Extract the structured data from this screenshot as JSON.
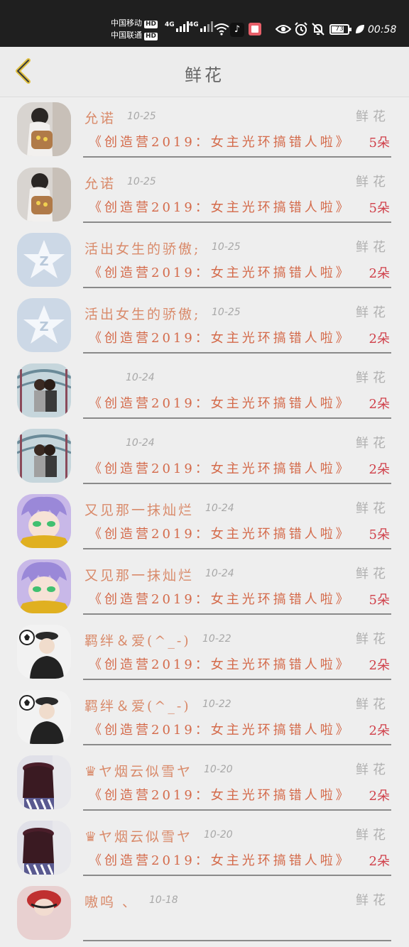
{
  "status_bar": {
    "carrier1": "中国移动",
    "carrier2": "中国联通",
    "hd_badge": "HD",
    "network1": "4G",
    "network2": "4G",
    "battery": "73",
    "time": "00:58",
    "icons": [
      "signal-icon",
      "wifi-icon",
      "tiktok-icon",
      "reader-app-icon",
      "eye-icon",
      "alarm-icon",
      "mute-bell-icon",
      "battery-icon",
      "leaf-icon"
    ]
  },
  "header": {
    "title": "鲜花",
    "back_icon": "chevron-left-icon",
    "accent_color": "#e0c040"
  },
  "rows": [
    {
      "name": "允诺",
      "date": "10-25",
      "gift_label": "鲜花",
      "work": "《创造营2019：女主光环搞错人啦》",
      "qty": "5朵",
      "avatar": "girl-backpack"
    },
    {
      "name": "允诺",
      "date": "10-25",
      "gift_label": "鲜花",
      "work": "《创造营2019：女主光环搞错人啦》",
      "qty": "5朵",
      "avatar": "girl-backpack"
    },
    {
      "name": "活出女生的骄傲;",
      "date": "10-25",
      "gift_label": "鲜花",
      "work": "《创造营2019：女主光环搞错人啦》",
      "qty": "2朵",
      "avatar": "qq-default"
    },
    {
      "name": "活出女生的骄傲;",
      "date": "10-25",
      "gift_label": "鲜花",
      "work": "《创造营2019：女主光环搞错人啦》",
      "qty": "2朵",
      "avatar": "qq-default"
    },
    {
      "name": "",
      "date": "10-24",
      "gift_label": "鲜花",
      "work": "《创造营2019：女主光环搞错人啦》",
      "qty": "2朵",
      "avatar": "couple-photo"
    },
    {
      "name": "",
      "date": "10-24",
      "gift_label": "鲜花",
      "work": "《创造营2019：女主光环搞错人啦》",
      "qty": "2朵",
      "avatar": "couple-photo"
    },
    {
      "name": "又见那一抹灿烂",
      "date": "10-24",
      "gift_label": "鲜花",
      "work": "《创造营2019：女主光环搞错人啦》",
      "qty": "5朵",
      "avatar": "anime-boy"
    },
    {
      "name": "又见那一抹灿烂",
      "date": "10-24",
      "gift_label": "鲜花",
      "work": "《创造营2019：女主光环搞错人啦》",
      "qty": "5朵",
      "avatar": "anime-boy"
    },
    {
      "name": "羁绊＆爱(^_-)",
      "date": "10-22",
      "gift_label": "鲜花",
      "work": "《创造营2019：女主光环搞错人啦》",
      "qty": "2朵",
      "avatar": "boy-soccer"
    },
    {
      "name": "羁绊＆爱(^_-)",
      "date": "10-22",
      "gift_label": "鲜花",
      "work": "《创造营2019：女主光环搞错人啦》",
      "qty": "2朵",
      "avatar": "boy-soccer"
    },
    {
      "name": "♛ヤ烟云似雪ヤ",
      "date": "10-20",
      "gift_label": "鲜花",
      "work": "《创造营2019：女主光环搞错人啦》",
      "qty": "2朵",
      "avatar": "girl-hat"
    },
    {
      "name": "♛ヤ烟云似雪ヤ",
      "date": "10-20",
      "gift_label": "鲜花",
      "work": "《创造营2019：女主光环搞错人啦》",
      "qty": "2朵",
      "avatar": "girl-hat"
    },
    {
      "name": "嗷呜 、",
      "date": "10-18",
      "gift_label": "鲜花",
      "work": "",
      "qty": "",
      "avatar": "girl-red"
    }
  ]
}
